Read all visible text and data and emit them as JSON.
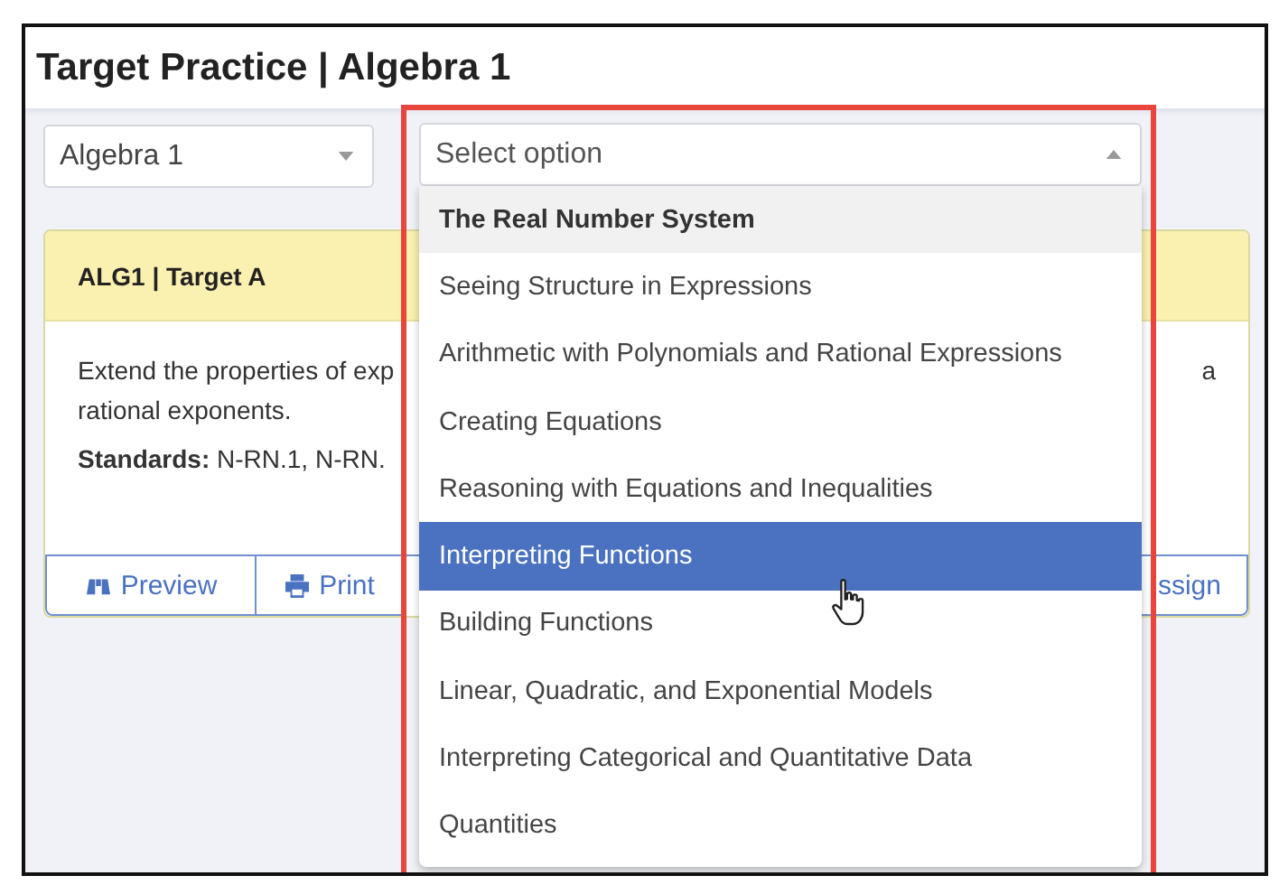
{
  "window": {
    "title": "Target Practice | Algebra 1"
  },
  "course_select": {
    "value": "Algebra 1"
  },
  "domain_select": {
    "placeholder": "Select option",
    "expanded": true,
    "options": [
      {
        "label": "The Real Number System",
        "kind": "current",
        "selected": false
      },
      {
        "label": "Seeing Structure in Expressions",
        "kind": "option",
        "selected": false
      },
      {
        "label": "Arithmetic with Polynomials and Rational Expressions",
        "kind": "option",
        "selected": false
      },
      {
        "label": "Creating Equations",
        "kind": "option",
        "selected": false
      },
      {
        "label": "Reasoning with Equations and Inequalities",
        "kind": "option",
        "selected": false
      },
      {
        "label": "Interpreting Functions",
        "kind": "option",
        "selected": true
      },
      {
        "label": "Building Functions",
        "kind": "option",
        "selected": false
      },
      {
        "label": "Linear, Quadratic, and Exponential Models",
        "kind": "option",
        "selected": false
      },
      {
        "label": "Interpreting Categorical and Quantitative Data",
        "kind": "option",
        "selected": false
      },
      {
        "label": "Quantities",
        "kind": "option",
        "selected": false
      }
    ]
  },
  "card": {
    "title": "ALG1 | Target A",
    "description_lines": [
      "Extend the properties of exp",
      "rational exponents."
    ],
    "description_right": "a",
    "standards": "**Standards:** N-RN.1, N-RN.",
    "buttons": [
      {
        "label": "Preview",
        "kind": "preview"
      },
      {
        "label": "Print",
        "kind": "print"
      },
      {
        "label": "ssign",
        "kind": "assign"
      }
    ]
  }
}
